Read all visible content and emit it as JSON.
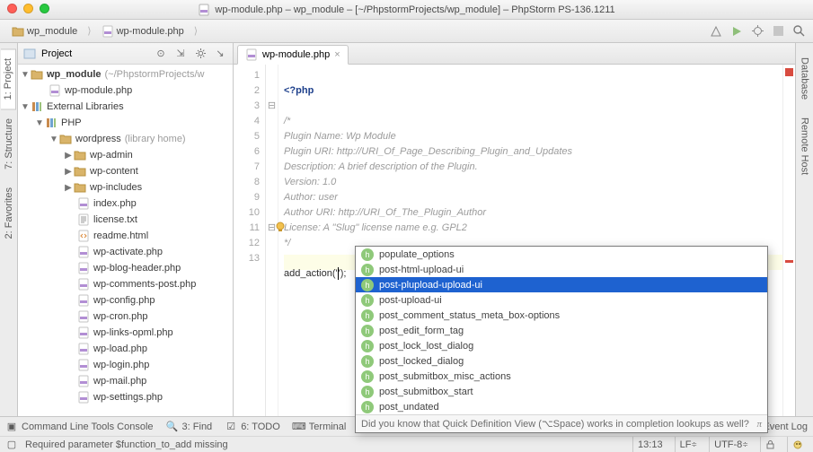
{
  "window": {
    "title": "wp-module.php – wp_module – [~/PhpstormProjects/wp_module] – PhpStorm PS-136.1211"
  },
  "breadcrumbs": {
    "project": "wp_module",
    "file": "wp-module.php"
  },
  "sidebar": {
    "title": "Project",
    "root": "wp_module",
    "root_hint": "(~/PhpstormProjects/w",
    "root_file": "wp-module.php",
    "ext_lib": "External Libraries",
    "php": "PHP",
    "wp": "wordpress",
    "wp_hint": "(library home)",
    "dirs": [
      "wp-admin",
      "wp-content",
      "wp-includes"
    ],
    "files": [
      "index.php",
      "license.txt",
      "readme.html",
      "wp-activate.php",
      "wp-blog-header.php",
      "wp-comments-post.php",
      "wp-config.php",
      "wp-cron.php",
      "wp-links-opml.php",
      "wp-load.php",
      "wp-login.php",
      "wp-mail.php",
      "wp-settings.php"
    ]
  },
  "tabs": {
    "file": "wp-module.php"
  },
  "code": {
    "l1": "<?php",
    "l3": "/*",
    "l4": "Plugin Name: Wp Module",
    "l5": "Plugin URI: http://URI_Of_Page_Describing_Plugin_and_Updates",
    "l6": "Description: A brief description of the Plugin.",
    "l7": "Version: 1.0",
    "l8": "Author: user",
    "l9": "Author URI: http://URI_Of_The_Plugin_Author",
    "l10": "License: A \"Slug\" license name e.g. GPL2",
    "l11": "*/",
    "l13a": "add_action",
    "l13b": "('",
    "l13c": "');"
  },
  "gutter": [
    "1",
    "2",
    "3",
    "4",
    "5",
    "6",
    "7",
    "8",
    "9",
    "10",
    "11",
    "12",
    "13"
  ],
  "completion": {
    "items": [
      "populate_options",
      "post-html-upload-ui",
      "post-plupload-upload-ui",
      "post-upload-ui",
      "post_comment_status_meta_box-options",
      "post_edit_form_tag",
      "post_lock_lost_dialog",
      "post_locked_dialog",
      "post_submitbox_misc_actions",
      "post_submitbox_start",
      "post_undated"
    ],
    "selected_index": 2,
    "hint": "Did you know that Quick Definition View (⌥Space) works in completion lookups as well?"
  },
  "left_rail": {
    "project": "1: Project",
    "structure": "7: Structure",
    "favorites": "2: Favorites"
  },
  "right_rail": {
    "database": "Database",
    "remote": "Remote Host"
  },
  "bottom": {
    "console": "Command Line Tools Console",
    "find": "3: Find",
    "todo": "6: TODO",
    "terminal": "Terminal",
    "eventlog": "Event Log"
  },
  "status": {
    "msg": "Required parameter $function_to_add missing",
    "pos": "13:13",
    "le": "LF",
    "enc": "UTF-8"
  }
}
